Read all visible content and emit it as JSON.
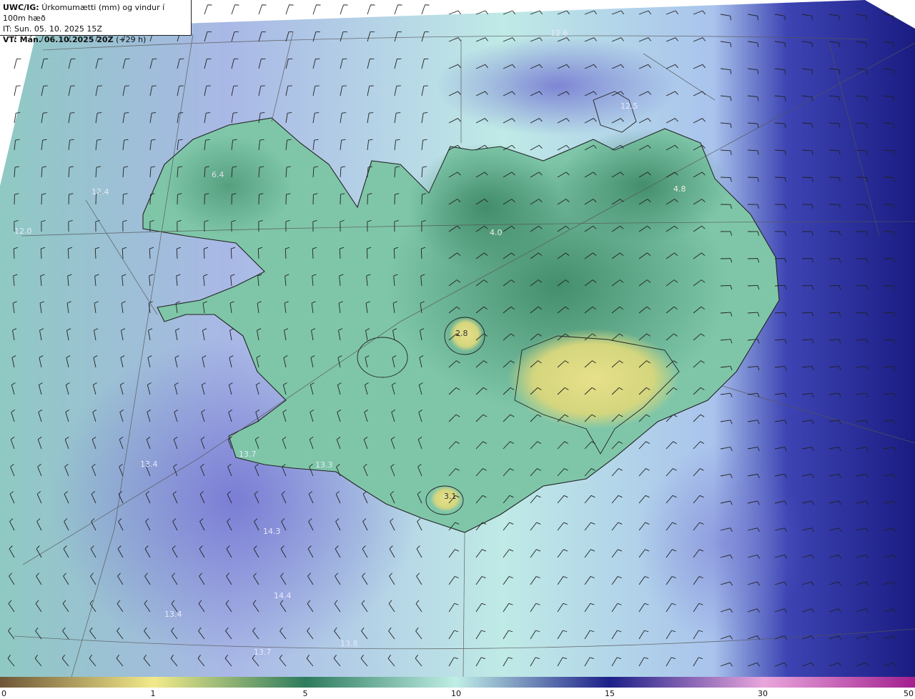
{
  "header": {
    "model": "UWC/IG:",
    "title": "Úrkomumætti (mm) og vindur í 100m hæð",
    "it": "IT: Sun. 05. 10. 2025 15Z",
    "vt_label": "VT: Mán. 06.10.2025 20Z",
    "vt_offset": "(+29 h)"
  },
  "map_labels": [
    {
      "text": "12.6"
    },
    {
      "text": "12.5"
    },
    {
      "text": "4.8"
    },
    {
      "text": "4.0"
    },
    {
      "text": "6.4"
    },
    {
      "text": "12.4"
    },
    {
      "text": "12.0"
    },
    {
      "text": "2.8"
    },
    {
      "text": "13.7"
    },
    {
      "text": "13.4"
    },
    {
      "text": "13.3"
    },
    {
      "text": "3.1"
    },
    {
      "text": "14.3"
    },
    {
      "text": "14.4"
    },
    {
      "text": "13.4"
    },
    {
      "text": "13.8"
    },
    {
      "text": "13.7"
    }
  ],
  "legend": {
    "ticks": [
      {
        "label": "0",
        "value": 0
      },
      {
        "label": "1",
        "value": 1
      },
      {
        "label": "5",
        "value": 5
      },
      {
        "label": "10",
        "value": 10
      },
      {
        "label": "15",
        "value": 15
      },
      {
        "label": "30",
        "value": 30
      },
      {
        "label": "50",
        "value": 50
      }
    ],
    "colors": [
      "#6e5638",
      "#f2ea8a",
      "#2d7b5d",
      "#bfeee6",
      "#1d1f88",
      "#e9a6dc",
      "#a21f8f"
    ]
  }
}
